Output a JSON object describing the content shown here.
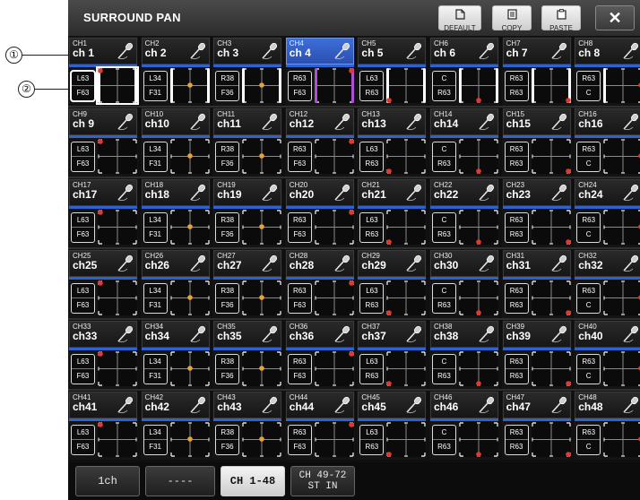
{
  "window": {
    "title": "SURROUND PAN"
  },
  "toolbar": {
    "default_label": "DEFAULT",
    "default_icon": "document-icon",
    "copy_label": "COPY",
    "copy_icon": "copy-icon",
    "paste_label": "PASTE",
    "paste_icon": "paste-icon",
    "close_icon": "close-icon",
    "close_glyph": "✕"
  },
  "callouts": [
    {
      "label": "①"
    },
    {
      "label": "②"
    }
  ],
  "colors": {
    "selected_channel": "#3a6bd6",
    "channel_bar": "#2f62d0",
    "pan_dot": "#e03a2e",
    "center_dot": "#e6a33a"
  },
  "selected_channel": "CH4",
  "channels": [
    {
      "id": "CH1",
      "name": "ch 1",
      "l": "L63",
      "r": "F63",
      "pos": "tl"
    },
    {
      "id": "CH2",
      "name": "ch 2",
      "l": "L34",
      "r": "F31",
      "pos": "center"
    },
    {
      "id": "CH3",
      "name": "ch 3",
      "l": "R38",
      "r": "F36",
      "pos": "center"
    },
    {
      "id": "CH4",
      "name": "ch 4",
      "l": "R63",
      "r": "F63",
      "pos": "tr"
    },
    {
      "id": "CH5",
      "name": "ch 5",
      "l": "L63",
      "r": "R63",
      "pos": "bl"
    },
    {
      "id": "CH6",
      "name": "ch 6",
      "l": "C",
      "r": "R63",
      "pos": "bc"
    },
    {
      "id": "CH7",
      "name": "ch 7",
      "l": "R63",
      "r": "R63",
      "pos": "br"
    },
    {
      "id": "CH8",
      "name": "ch 8",
      "l": "R63",
      "r": "C",
      "pos": "mr"
    },
    {
      "id": "CH9",
      "name": "ch 9",
      "l": "L63",
      "r": "F63",
      "pos": "tl"
    },
    {
      "id": "CH10",
      "name": "ch10",
      "l": "L34",
      "r": "F31",
      "pos": "center"
    },
    {
      "id": "CH11",
      "name": "ch11",
      "l": "R38",
      "r": "F36",
      "pos": "center"
    },
    {
      "id": "CH12",
      "name": "ch12",
      "l": "R63",
      "r": "F63",
      "pos": "tr"
    },
    {
      "id": "CH13",
      "name": "ch13",
      "l": "L63",
      "r": "R63",
      "pos": "bl"
    },
    {
      "id": "CH14",
      "name": "ch14",
      "l": "C",
      "r": "R63",
      "pos": "bc"
    },
    {
      "id": "CH15",
      "name": "ch15",
      "l": "R63",
      "r": "R63",
      "pos": "br"
    },
    {
      "id": "CH16",
      "name": "ch16",
      "l": "R63",
      "r": "C",
      "pos": "mr"
    },
    {
      "id": "CH17",
      "name": "ch17",
      "l": "L63",
      "r": "F63",
      "pos": "tl"
    },
    {
      "id": "CH18",
      "name": "ch18",
      "l": "L34",
      "r": "F31",
      "pos": "center"
    },
    {
      "id": "CH19",
      "name": "ch19",
      "l": "R38",
      "r": "F36",
      "pos": "center"
    },
    {
      "id": "CH20",
      "name": "ch20",
      "l": "R63",
      "r": "F63",
      "pos": "tr"
    },
    {
      "id": "CH21",
      "name": "ch21",
      "l": "L63",
      "r": "R63",
      "pos": "bl"
    },
    {
      "id": "CH22",
      "name": "ch22",
      "l": "C",
      "r": "R63",
      "pos": "bc"
    },
    {
      "id": "CH23",
      "name": "ch23",
      "l": "R63",
      "r": "R63",
      "pos": "br"
    },
    {
      "id": "CH24",
      "name": "ch24",
      "l": "R63",
      "r": "C",
      "pos": "mr"
    },
    {
      "id": "CH25",
      "name": "ch25",
      "l": "L63",
      "r": "F63",
      "pos": "tl"
    },
    {
      "id": "CH26",
      "name": "ch26",
      "l": "L34",
      "r": "F31",
      "pos": "center"
    },
    {
      "id": "CH27",
      "name": "ch27",
      "l": "R38",
      "r": "F36",
      "pos": "center"
    },
    {
      "id": "CH28",
      "name": "ch28",
      "l": "R63",
      "r": "F63",
      "pos": "tr"
    },
    {
      "id": "CH29",
      "name": "ch29",
      "l": "L63",
      "r": "R63",
      "pos": "bl"
    },
    {
      "id": "CH30",
      "name": "ch30",
      "l": "C",
      "r": "R63",
      "pos": "bc"
    },
    {
      "id": "CH31",
      "name": "ch31",
      "l": "R63",
      "r": "R63",
      "pos": "br"
    },
    {
      "id": "CH32",
      "name": "ch32",
      "l": "R63",
      "r": "C",
      "pos": "mr"
    },
    {
      "id": "CH33",
      "name": "ch33",
      "l": "L63",
      "r": "F63",
      "pos": "tl"
    },
    {
      "id": "CH34",
      "name": "ch34",
      "l": "L34",
      "r": "F31",
      "pos": "center"
    },
    {
      "id": "CH35",
      "name": "ch35",
      "l": "R38",
      "r": "F36",
      "pos": "center"
    },
    {
      "id": "CH36",
      "name": "ch36",
      "l": "R63",
      "r": "F63",
      "pos": "tr"
    },
    {
      "id": "CH37",
      "name": "ch37",
      "l": "L63",
      "r": "R63",
      "pos": "bl"
    },
    {
      "id": "CH38",
      "name": "ch38",
      "l": "C",
      "r": "R63",
      "pos": "bc"
    },
    {
      "id": "CH39",
      "name": "ch39",
      "l": "R63",
      "r": "R63",
      "pos": "br"
    },
    {
      "id": "CH40",
      "name": "ch40",
      "l": "R63",
      "r": "C",
      "pos": "mr"
    },
    {
      "id": "CH41",
      "name": "ch41",
      "l": "L63",
      "r": "F63",
      "pos": "tl"
    },
    {
      "id": "CH42",
      "name": "ch42",
      "l": "L34",
      "r": "F31",
      "pos": "center"
    },
    {
      "id": "CH43",
      "name": "ch43",
      "l": "R38",
      "r": "F36",
      "pos": "center"
    },
    {
      "id": "CH44",
      "name": "ch44",
      "l": "R63",
      "r": "F63",
      "pos": "tr"
    },
    {
      "id": "CH45",
      "name": "ch45",
      "l": "L63",
      "r": "R63",
      "pos": "bl"
    },
    {
      "id": "CH46",
      "name": "ch46",
      "l": "C",
      "r": "R63",
      "pos": "bc"
    },
    {
      "id": "CH47",
      "name": "ch47",
      "l": "R63",
      "r": "R63",
      "pos": "br"
    },
    {
      "id": "CH48",
      "name": "ch48",
      "l": "R63",
      "r": "C",
      "pos": "mr"
    }
  ],
  "tabs": [
    {
      "label": "1ch",
      "active": false
    },
    {
      "label": "----",
      "active": false
    },
    {
      "label": "CH 1-48",
      "active": true
    },
    {
      "label": "CH 49-72\nST IN",
      "active": false
    }
  ]
}
